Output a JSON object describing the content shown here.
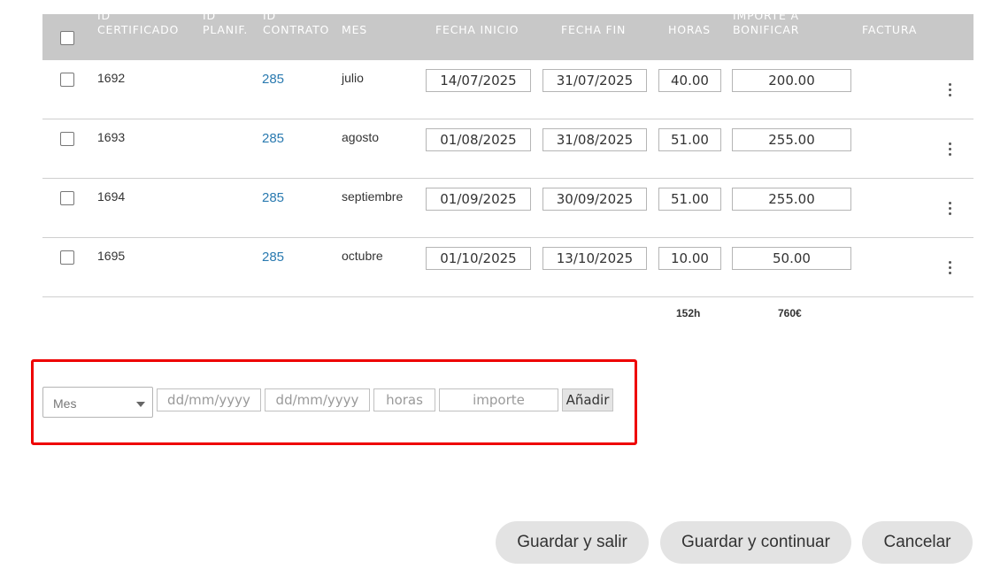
{
  "table": {
    "headers": {
      "id_certificado": [
        "ID",
        "CERTIFICADO"
      ],
      "id_planif": [
        "ID",
        "PLANIF."
      ],
      "id_contrato": [
        "ID",
        "CONTRATO"
      ],
      "mes": "MES",
      "fecha_inicio": "FECHA INICIO",
      "fecha_fin": "FECHA FIN",
      "horas": "HORAS",
      "importe": [
        "IMPORTE A",
        "BONIFICAR"
      ],
      "factura": "FACTURA"
    },
    "rows": [
      {
        "id_certificado": "1692",
        "id_contrato": "285",
        "mes": "julio",
        "fecha_inicio": "14/07/2025",
        "fecha_fin": "31/07/2025",
        "horas": "40.00",
        "importe": "200.00"
      },
      {
        "id_certificado": "1693",
        "id_contrato": "285",
        "mes": "agosto",
        "fecha_inicio": "01/08/2025",
        "fecha_fin": "31/08/2025",
        "horas": "51.00",
        "importe": "255.00"
      },
      {
        "id_certificado": "1694",
        "id_contrato": "285",
        "mes": "septiembre",
        "fecha_inicio": "01/09/2025",
        "fecha_fin": "30/09/2025",
        "horas": "51.00",
        "importe": "255.00"
      },
      {
        "id_certificado": "1695",
        "id_contrato": "285",
        "mes": "octubre",
        "fecha_inicio": "01/10/2025",
        "fecha_fin": "13/10/2025",
        "horas": "10.00",
        "importe": "50.00"
      }
    ],
    "totals": {
      "horas": "152h",
      "importe": "760€"
    },
    "row_menu_icon": "kebab-vertical-icon"
  },
  "add_form": {
    "mes_select": {
      "selected": "Mes"
    },
    "fecha_inicio_placeholder": "dd/mm/yyyy",
    "fecha_fin_placeholder": "dd/mm/yyyy",
    "horas_placeholder": "horas",
    "importe_placeholder": "importe",
    "add_button": "Añadir",
    "highlight_color": "#ee0000"
  },
  "actions": {
    "save_exit": "Guardar y salir",
    "save_continue": "Guardar y continuar",
    "cancel": "Cancelar"
  },
  "colors": {
    "header_bg": "#c8c8c8",
    "link": "#2a7ab0",
    "button_bg": "#e3e3e3"
  }
}
